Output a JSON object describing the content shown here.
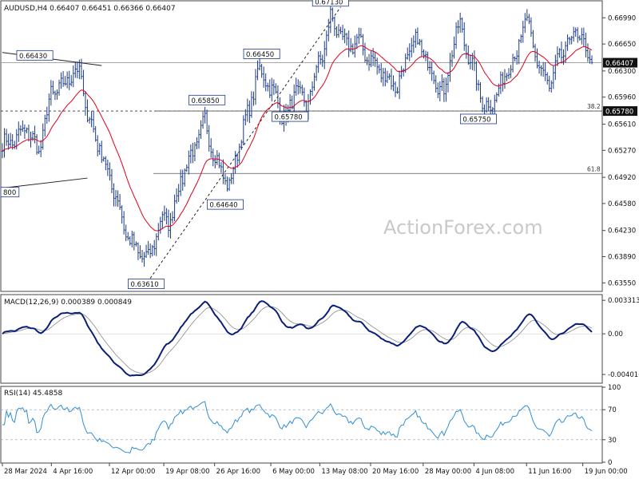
{
  "header": {
    "symbol_line": "AUDUSD,H4  0.66407 0.66451 0.66366 0.66407"
  },
  "watermark": "ActionForex.com",
  "colors": {
    "price": "#1a3a8a",
    "ema": "#e0001b",
    "macd": "#0a1f7a",
    "signal": "#8a8a8a",
    "rsi": "#2f8fd6",
    "grid": "#c8c8c8",
    "text": "#111111"
  },
  "chart_data": [
    {
      "type": "line",
      "panel": "price",
      "ylim": [
        0.6345,
        0.672
      ],
      "yticks": [
        "0.66990",
        "0.66650",
        "0.66300",
        "0.65960",
        "0.65610",
        "0.65270",
        "0.64920",
        "0.64580",
        "0.64230",
        "0.63890",
        "0.63550"
      ],
      "ytick_values": [
        0.6699,
        0.6665,
        0.663,
        0.6596,
        0.6561,
        0.6527,
        0.6492,
        0.6458,
        0.6423,
        0.6389,
        0.6355
      ],
      "current_price_label": "0.66407",
      "current_price_value": 0.66407,
      "level_label": "0.65780",
      "level_value": 0.6578,
      "fib_levels": [
        {
          "name": "38.2",
          "value": 0.6578
        },
        {
          "name": "61.8",
          "value": 0.6497
        }
      ],
      "price_labels": [
        {
          "text": "0.66430",
          "bar": 16,
          "value": 0.6643
        },
        {
          "text": "0.67130",
          "bar": 162,
          "value": 0.6713
        },
        {
          "text": "0.66450",
          "bar": 128,
          "value": 0.6645
        },
        {
          "text": "0.65850",
          "bar": 101,
          "value": 0.6585
        },
        {
          "text": "0.65780",
          "bar": 142,
          "value": 0.6578
        },
        {
          "text": "0.65750",
          "bar": 235,
          "value": 0.6575
        },
        {
          "text": "0.64640",
          "bar": 110,
          "value": 0.6464
        },
        {
          "text": "0.63610",
          "bar": 71,
          "value": 0.6361
        },
        {
          "text": "800",
          "bar": 0,
          "value": 0.648
        }
      ],
      "close_anchors": [
        [
          0,
          0.6535
        ],
        [
          6,
          0.654
        ],
        [
          12,
          0.6555
        ],
        [
          18,
          0.6525
        ],
        [
          24,
          0.66
        ],
        [
          30,
          0.661
        ],
        [
          35,
          0.663
        ],
        [
          39,
          0.6625
        ],
        [
          41,
          0.658
        ],
        [
          44,
          0.656
        ],
        [
          48,
          0.653
        ],
        [
          53,
          0.649
        ],
        [
          57,
          0.646
        ],
        [
          61,
          0.642
        ],
        [
          65,
          0.64
        ],
        [
          69,
          0.639
        ],
        [
          72,
          0.6385
        ],
        [
          75,
          0.641
        ],
        [
          79,
          0.644
        ],
        [
          83,
          0.6435
        ],
        [
          87,
          0.648
        ],
        [
          91,
          0.651
        ],
        [
          95,
          0.653
        ],
        [
          100,
          0.6565
        ],
        [
          104,
          0.6525
        ],
        [
          108,
          0.65
        ],
        [
          112,
          0.648
        ],
        [
          114,
          0.65
        ],
        [
          118,
          0.655
        ],
        [
          122,
          0.658
        ],
        [
          126,
          0.663
        ],
        [
          130,
          0.662
        ],
        [
          134,
          0.66
        ],
        [
          138,
          0.6575
        ],
        [
          141,
          0.657
        ],
        [
          145,
          0.661
        ],
        [
          150,
          0.658
        ],
        [
          154,
          0.6625
        ],
        [
          158,
          0.665
        ],
        [
          162,
          0.67
        ],
        [
          166,
          0.668
        ],
        [
          170,
          0.666
        ],
        [
          175,
          0.667
        ],
        [
          180,
          0.665
        ],
        [
          185,
          0.6635
        ],
        [
          190,
          0.662
        ],
        [
          195,
          0.661
        ],
        [
          200,
          0.665
        ],
        [
          205,
          0.667
        ],
        [
          210,
          0.664
        ],
        [
          214,
          0.662
        ],
        [
          218,
          0.66
        ],
        [
          222,
          0.666
        ],
        [
          226,
          0.669
        ],
        [
          230,
          0.665
        ],
        [
          234,
          0.662
        ],
        [
          238,
          0.658
        ],
        [
          242,
          0.659
        ],
        [
          246,
          0.661
        ],
        [
          250,
          0.664
        ],
        [
          254,
          0.665
        ],
        [
          258,
          0.67
        ],
        [
          262,
          0.666
        ],
        [
          266,
          0.663
        ],
        [
          270,
          0.661
        ],
        [
          274,
          0.664
        ],
        [
          278,
          0.666
        ],
        [
          282,
          0.668
        ],
        [
          286,
          0.667
        ],
        [
          290,
          0.6641
        ]
      ],
      "trendlines": [
        {
          "from": [
            0,
            0.6654
          ],
          "to": [
            49,
            0.6637
          ]
        },
        {
          "from": [
            0,
            0.6478
          ],
          "to": [
            42,
            0.6491
          ]
        },
        {
          "from": [
            73,
            0.6361
          ],
          "to": [
            167,
            0.6713
          ],
          "dashed": true
        }
      ]
    },
    {
      "type": "line",
      "panel": "macd",
      "title": "MACD(12,26,9) 0.000389 0.000849",
      "ylim": [
        -0.0048,
        0.0038
      ],
      "yticks": [
        "0.003313",
        "0.00",
        "-0.004016"
      ],
      "ytick_values": [
        0.003313,
        0.0,
        -0.004016
      ],
      "series": [
        {
          "name": "MACD"
        },
        {
          "name": "Signal"
        }
      ]
    },
    {
      "type": "line",
      "panel": "rsi",
      "title": "RSI(14) 45.4858",
      "ylim": [
        0,
        100
      ],
      "yticks": [
        "100",
        "70",
        "30",
        "0"
      ],
      "ytick_values": [
        100,
        70,
        30,
        0
      ],
      "guides": [
        70,
        30
      ]
    }
  ],
  "x_axis": {
    "labels": [
      {
        "text": "28 Mar 2024",
        "bar": 0
      },
      {
        "text": "4 Apr 16:00",
        "bar": 27
      },
      {
        "text": "12 Apr 00:00",
        "bar": 59
      },
      {
        "text": "19 Apr 08:00",
        "bar": 89
      },
      {
        "text": "26 Apr 16:00",
        "bar": 117
      },
      {
        "text": "6 May 00:00",
        "bar": 148
      },
      {
        "text": "13 May 08:00",
        "bar": 175
      },
      {
        "text": "20 May 16:00",
        "bar": 203
      },
      {
        "text": "28 May 00:00",
        "bar": 232
      },
      {
        "text": "4 Jun 08:00",
        "bar": 260
      },
      {
        "text": "11 Jun 16:00",
        "bar": 289
      },
      {
        "text": "19 Jun 00:00",
        "bar": 320
      }
    ]
  }
}
